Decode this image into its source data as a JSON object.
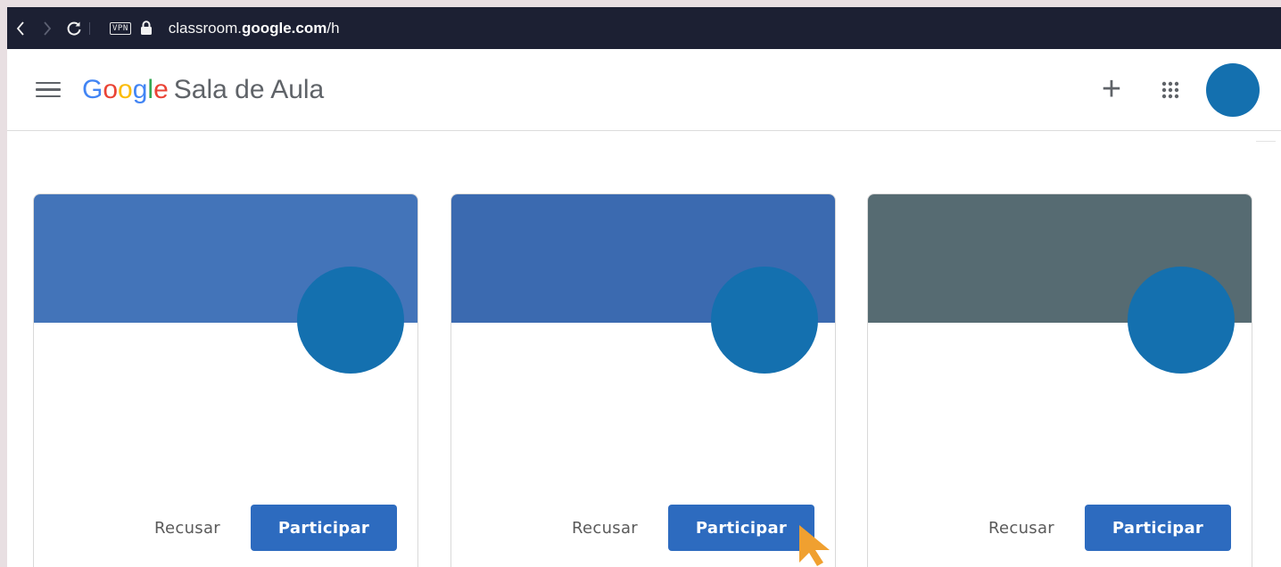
{
  "browser": {
    "back_icon": "chevron-left-icon",
    "forward_icon": "chevron-right-icon",
    "reload_icon": "reload-icon",
    "vpn_label": "VPN",
    "url_prefix": "classroom.",
    "url_domain": "google.com",
    "url_suffix": "/h"
  },
  "header": {
    "menu_icon": "hamburger-menu-icon",
    "logo_letters": [
      "G",
      "o",
      "o",
      "g",
      "l",
      "e"
    ],
    "app_name": "Sala de Aula",
    "add_icon": "plus-icon",
    "add_symbol": "+",
    "apps_icon": "apps-grid-icon"
  },
  "cards": [
    {
      "banner_color": "#4374b9",
      "decline_label": "Recusar",
      "join_label": "Participar"
    },
    {
      "banner_color": "#3b6ab0",
      "decline_label": "Recusar",
      "join_label": "Participar"
    },
    {
      "banner_color": "#566b72",
      "decline_label": "Recusar",
      "join_label": "Participar"
    }
  ],
  "colors": {
    "browser_bar": "#1c2033",
    "avatar": "#1470af",
    "join_button": "#2d6bbf",
    "cursor": "#f0a030"
  }
}
